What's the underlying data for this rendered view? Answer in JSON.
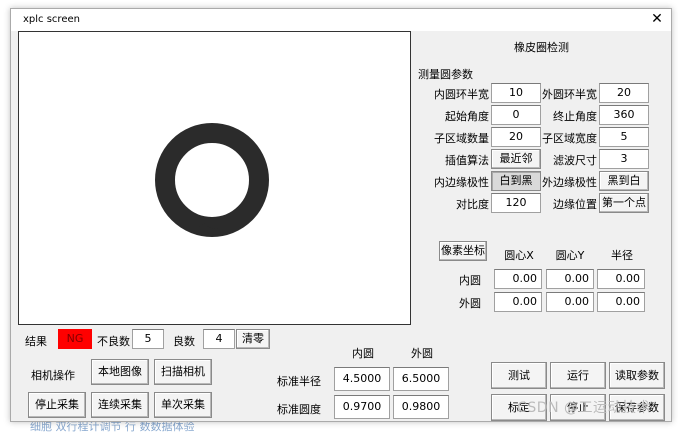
{
  "window": {
    "title": "xplc screen",
    "close_glyph": "✕"
  },
  "right_panel": {
    "heading": "橡皮圈检测",
    "params_heading": "测量圆参数",
    "params": [
      {
        "label": "内圆环半宽",
        "value": "10",
        "label2": "外圆环半宽",
        "value2": "20"
      },
      {
        "label": "起始角度",
        "value": "0",
        "label2": "终止角度",
        "value2": "360"
      },
      {
        "label": "子区域数量",
        "value": "20",
        "label2": "子区域宽度",
        "value2": "5"
      },
      {
        "label": "插值算法",
        "value": "最近邻",
        "label2": "滤波尺寸",
        "value2": "3"
      },
      {
        "label": "内边缘极性",
        "value": "白到黑",
        "label2": "外边缘极性",
        "value2": "黑到白"
      },
      {
        "label": "对比度",
        "value": "120",
        "label2": "边缘位置",
        "value2": "第一个点"
      }
    ],
    "coords": {
      "button_label": "像素坐标",
      "col_x": "圆心X",
      "col_y": "圆心Y",
      "col_r": "半径",
      "rows": [
        {
          "label": "内圆",
          "x": "0.00",
          "y": "0.00",
          "r": "0.00"
        },
        {
          "label": "外圆",
          "x": "0.00",
          "y": "0.00",
          "r": "0.00"
        }
      ]
    }
  },
  "result": {
    "label": "结果",
    "status": "NG",
    "status_color": "#ff0000",
    "bad_label": "不良数",
    "bad_value": "5",
    "good_label": "良数",
    "good_value": "4",
    "clear_label": "清零"
  },
  "camera": {
    "label": "相机操作",
    "local_image": "本地图像",
    "scan_camera": "扫描相机",
    "stop_capture": "停止采集",
    "continuous_capture": "连续采集",
    "single_capture": "单次采集"
  },
  "standard": {
    "inner_header": "内圆",
    "outer_header": "外圆",
    "radius_label": "标准半径",
    "roundness_label": "标准圆度",
    "radius_inner": "4.5000",
    "radius_outer": "6.5000",
    "roundness_inner": "0.9700",
    "roundness_outer": "0.9800"
  },
  "actions": {
    "test": "测试",
    "run": "运行",
    "read_params": "读取参数",
    "calibrate": "标定",
    "stop": "停止",
    "save_params": "保存参数"
  },
  "watermark": "CSDN @工运动技术",
  "background_text": "细胞 双行程计调节 行 数数据体验"
}
